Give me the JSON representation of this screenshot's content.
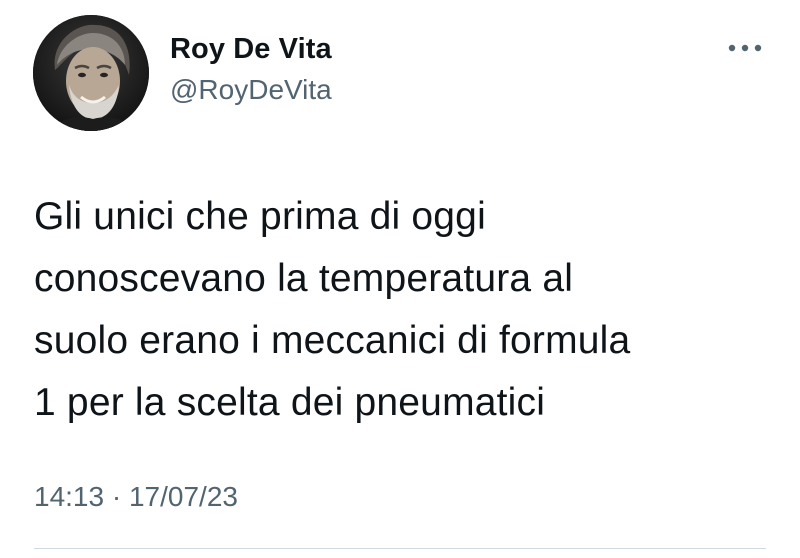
{
  "author": {
    "display_name": "Roy De Vita",
    "handle": "@RoyDeVita"
  },
  "tweet": {
    "lines": [
      "Gli unici che prima di oggi",
      "conoscevano la temperatura al",
      "suolo erano i meccanici di formula",
      "1 per la scelta dei pneumatici"
    ],
    "time": "14:13",
    "separator": "·",
    "date": "17/07/23"
  },
  "icons": {
    "more": "more-horizontal-icon",
    "avatar": "profile-photo"
  },
  "colors": {
    "text_primary": "#0f1419",
    "text_secondary": "#536471",
    "divider": "#cfd9de"
  }
}
